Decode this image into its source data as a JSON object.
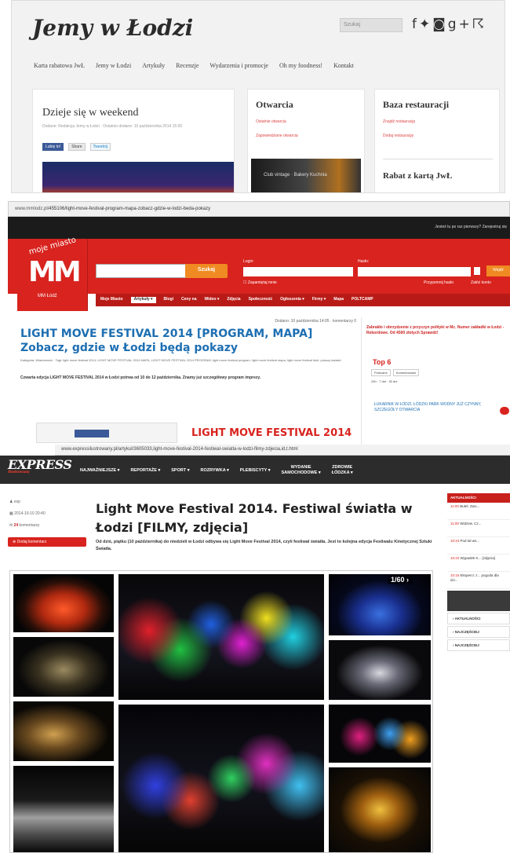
{
  "panel1": {
    "logo": "Jemy w Łodzi",
    "search_placeholder": "Szukaj",
    "social_icons": [
      "facebook-icon",
      "twitter-icon",
      "instagram-icon",
      "google-plus-icon",
      "rss-icon"
    ],
    "nav": [
      "Karta rabatowa JwŁ",
      "Jemy w Łodzi",
      "Artykuły",
      "Recenzje",
      "Wydarzenia i promocje",
      "Oh my foodness!",
      "Kontakt"
    ],
    "card1": {
      "title": "Dzieje się w weekend",
      "meta": "Dodane: Redakcja Jemy w Łodzi · Ostatnio dodano: 10 października 2014 15:00",
      "share": {
        "like": "Lubię to!",
        "share": "Share",
        "tweet": "Tweetnij"
      }
    },
    "card2": {
      "title": "Otwarcia",
      "links": [
        "Ostatnie otwarcia",
        "Zapowiedziane otwarcia"
      ],
      "img_caption": "Club vintage · Bakery Kuchnia"
    },
    "card3": {
      "title": "Baza restauracji",
      "links": [
        "Znajdź restaurację",
        "Dodaj restaurację"
      ],
      "title2": "Rabat z kartą JwŁ"
    }
  },
  "panel2": {
    "url_host": "www.mmlodz.pl",
    "url_path": "/455106/light-move-festival-program-mapa-zobacz-gdzie-w-lodzi-beda-pokazy",
    "top_right": "Jesteś tu po raz pierwszy? Zarejestruj się",
    "logo_top": "moje miasto",
    "logo_mm": "MM",
    "logo_sub": "MM Łódź",
    "search_btn": "Szukaj",
    "login_label": "Login:",
    "pass_label": "Hasło:",
    "remember": "Zapamiętaj mnie",
    "forgot": "Przypomnij hasło",
    "register": "Załóż konto",
    "login_btn": "Wejdź",
    "menu": [
      "Moje Miasto",
      "Artykuły ▾",
      "Blogi",
      "Ceny na",
      "Wideo ▾",
      "Zdjęcia",
      "Społeczność",
      "Ogłoszenia ▾",
      "Firmy ▾",
      "Mapa",
      "POLTCAMP"
    ],
    "date": "Dodano: 10 października 14:05 · komentarzy 0",
    "title": "LIGHT MOVE FESTIVAL 2014 [PROGRAM, MAPA] Zobacz, gdzie w Łodzi będą pokazy",
    "tags": "Kategoria: Wiadomości · Tagi: light move festival 2014, LIGHT MOVE FESTIVAL 2014 MAPA, LIGHT MOVE FESTIVAL 2014 PROGRAM, light move festival program, light move festival mapa, light move festival łódź, pokazy świateł",
    "lead": "Czwarta edycja LIGHT MOVE FESTIVAL 2014 w Łodzi potrwa od 10 do 12 października. Znamy już szczegółowy program imprezy.",
    "next_title": "LIGHT MOVE FESTIVAL 2014",
    "side_text": "Zabrakło i obrzydzenie z przyczyn polityki w Mc. Numer zakładki w Łodzi - Rekordowe. Od 4500 złotych Sprawdź!",
    "top6": "Top 6",
    "side_tabs": [
      "Polecane",
      "Komentowane"
    ],
    "side_subtabs": "24h · 7 dni · 30 dni",
    "side_link": "ŁUKARNIK W ŁODZI, ŁÓDZKI PARK WODNY JUŻ CZYNNY, SZCZEGÓŁY OTWARCIA"
  },
  "panel3": {
    "url": "www.expressilustrowany.pl/artykul/3605033,light-move-festival-2014-festiwal-swiatla-w-lodzi-filmy-zdjecia,id,t.html",
    "logo": "EXPRESS",
    "logo_sub": "Ilustrowany",
    "menu": [
      "NAJWAŻNIEJSZE ▾",
      "REPORTAŻE ▾",
      "SPORT ▾",
      "ROZRYWKA ▾",
      "PLEBISCYTY ▾"
    ],
    "menu_stack": [
      [
        "WYDANIE",
        "SAMOCHODOWE ▾"
      ],
      [
        "ZDROWIE",
        "ŁÓDZKA ▾"
      ]
    ],
    "author": "exp",
    "datetime": "2014-10-10 20:40",
    "comments_count": "24",
    "comments_word": "komentarzy",
    "add_comment": "Dodaj komentarz",
    "title": "Light Move Festival 2014. Festiwal światła w Łodzi [FILMY, zdjęcia]",
    "lead": "Od dziś, piątku (10 października) do niedzieli w Łodzi odbywa się Light Move Festival 2014, czyli festiwal światła. Jest to kolejna edycja Festiwalu Kinetycznej Sztuki Światła.",
    "gallery_counter": "1/60 ›",
    "side_header": "AKTUALNOŚCI",
    "side_items": [
      {
        "time": "11:00",
        "text": "Butel. Zwo..."
      },
      {
        "time": "11:00",
        "text": "Widzew. Cz..."
      },
      {
        "time": "10:44",
        "text": "Pod tal ws..."
      },
      {
        "time": "10:22",
        "text": "Wypadek K... [zdjęcia]"
      },
      {
        "time": "10:16",
        "text": "Eksperci: z... pogoda dla dzi..."
      }
    ],
    "side_links": [
      "AKTUALNOŚCI",
      "NAJCZĘŚCIEJ",
      "NAJCZĘŚCIEJ"
    ]
  }
}
